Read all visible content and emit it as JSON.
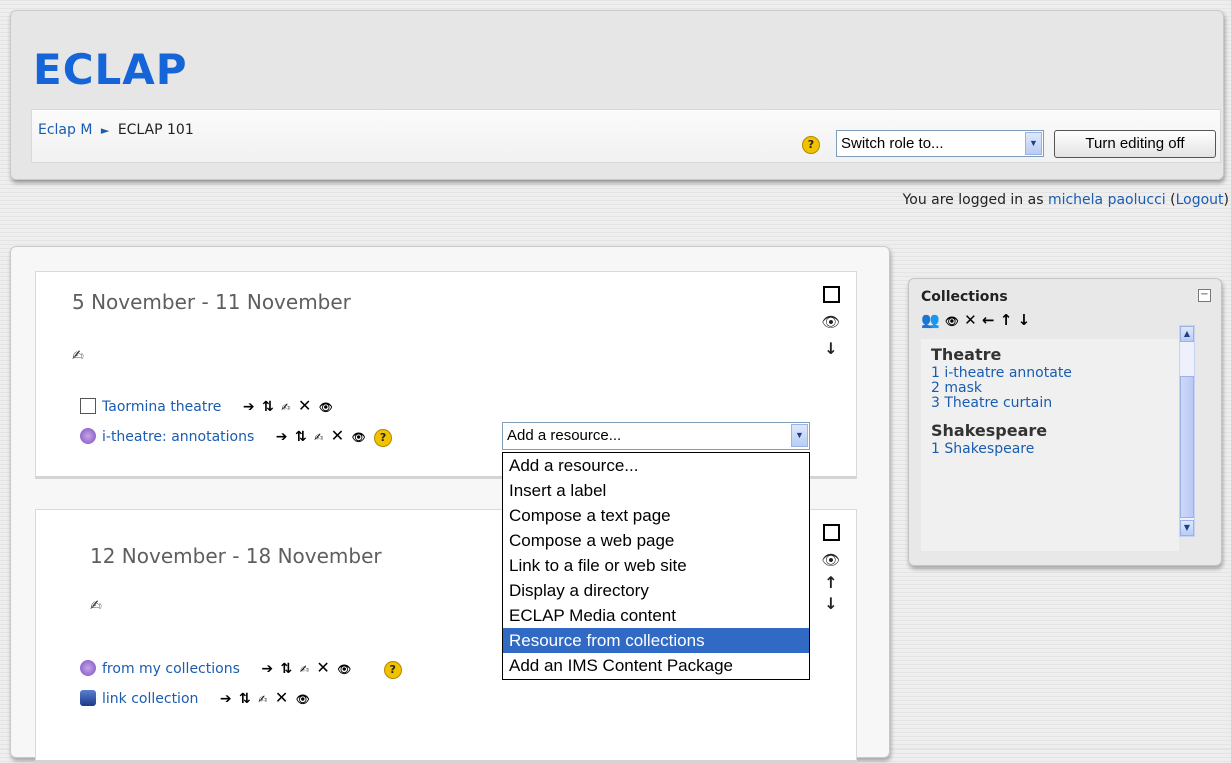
{
  "header": {
    "logo": "ECLAP",
    "breadcrumb": {
      "root": "Eclap M",
      "separator": "►",
      "current": "ECLAP 101"
    },
    "switch_role": {
      "value": "Switch role to..."
    },
    "edit_button": "Turn editing off"
  },
  "login": {
    "prefix": "You are logged in as",
    "user": "michela paolucci",
    "logout": "Logout"
  },
  "weeks": [
    {
      "title": "5 November - 11 November",
      "resources": [
        {
          "label": "Taormina theatre",
          "icon": "page-icon"
        },
        {
          "label": "i-theatre: annotations",
          "icon": "annotation-icon"
        }
      ]
    },
    {
      "title": "12 November - 18 November",
      "resources": [
        {
          "label": "from my collections",
          "icon": "annotation-icon"
        },
        {
          "label": "link collection",
          "icon": "link-icon"
        }
      ]
    }
  ],
  "add_resource": {
    "value": "Add a resource...",
    "options": [
      "Add a resource...",
      "Insert a label",
      "Compose a text page",
      "Compose a web page",
      "Link to a file or web site",
      "Display a directory",
      "ECLAP Media content",
      "Resource from collections",
      "Add an IMS Content Package"
    ],
    "highlighted": "Resource from collections"
  },
  "collections": {
    "title": "Collections",
    "groups": [
      {
        "name": "Theatre",
        "items": [
          "1 i-theatre annotate",
          "2 mask",
          "3 Theatre curtain"
        ]
      },
      {
        "name": "Shakespeare",
        "items": [
          "1 Shakespeare"
        ]
      }
    ]
  },
  "colors": {
    "logo": "#1565d8",
    "link": "#1a5cb0",
    "highlight": "#316ac5"
  }
}
